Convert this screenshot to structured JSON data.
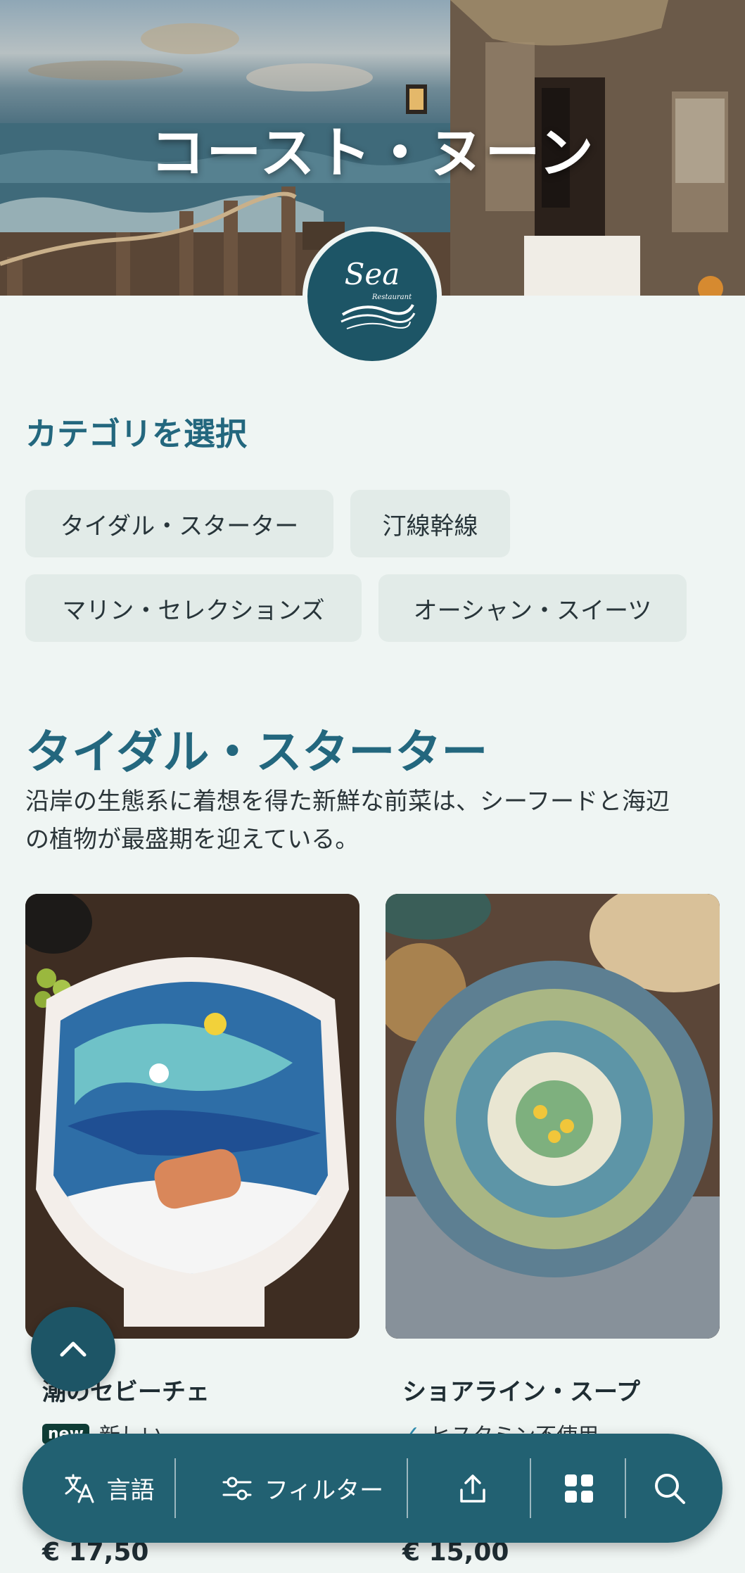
{
  "hero": {
    "title": "コースト・ヌーン",
    "logo_text": "Sea",
    "logo_subtext": "Restaurant"
  },
  "categories": {
    "heading": "カテゴリを選択",
    "items": [
      {
        "label": "タイダル・スターター"
      },
      {
        "label": "汀線幹線"
      },
      {
        "label": "マリン・セレクションズ"
      },
      {
        "label": "オーシャン・スイーツ"
      }
    ]
  },
  "section": {
    "title": "タイダル・スターター",
    "description_line1": "沿岸の生態系に着想を得た新鮮な前菜は、シーフードと海辺",
    "description_line2": "の植物が最盛期を迎えている。"
  },
  "dishes": [
    {
      "name": "潮のセビーチェ",
      "badge": "new",
      "tag": "新しい",
      "price": "€ 17,50"
    },
    {
      "name": "ショアライン・スープ",
      "tag": "ヒスタミン不使用",
      "price": "€ 15,00"
    }
  ],
  "toolbar": {
    "language_label": "言語",
    "filter_label": "フィルター"
  },
  "icons": {
    "scroll_top": "chevron-up-icon",
    "language": "translate-icon",
    "filter": "sliders-icon",
    "share": "share-icon",
    "grid": "grid-icon",
    "search": "search-icon"
  },
  "colors": {
    "accent": "#23677e",
    "bar": "#226172",
    "background": "#eff5f3",
    "chip": "#e2ebe8"
  }
}
